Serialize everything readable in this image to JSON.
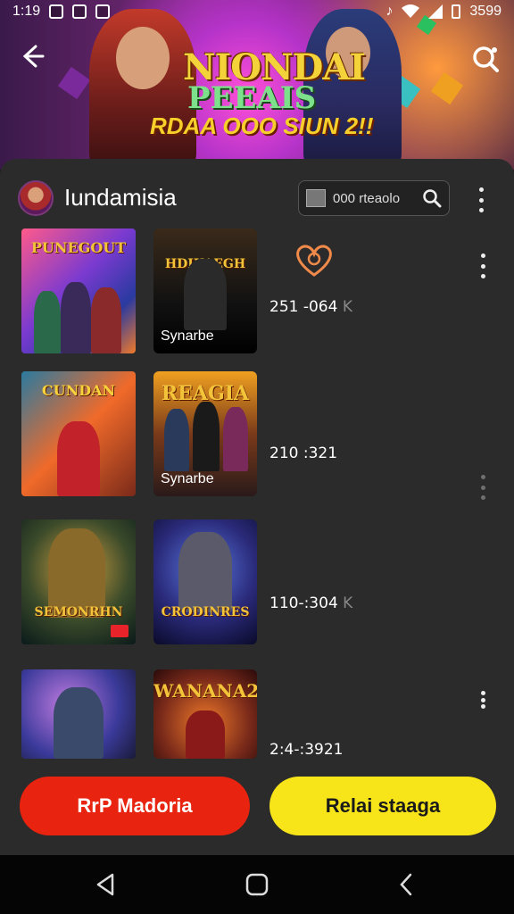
{
  "status_bar": {
    "time": "1:19",
    "right_text": "3599"
  },
  "hero": {
    "title": "NIONDAI",
    "subtitle": "PEEAIS",
    "tagline": "RDAA OOO SIUN 2!!"
  },
  "channel": {
    "name": "Iundamisia",
    "search_placeholder": "000 rteaolo"
  },
  "rows": [
    {
      "tile1_label": "PUNEGOUT",
      "tile2_label": "HDIKAEGH",
      "tile2_caption": "Synarbe",
      "stat": "251 -064",
      "stat_tail": "K"
    },
    {
      "tile1_label": "CUNDAN",
      "tile2_label": "REAGIA",
      "tile2_caption": "Synarbe",
      "stat": "210 :321",
      "stat_tail": ""
    },
    {
      "tile1_label": "SEMONRHN",
      "tile2_label": "CRODINRES",
      "tile2_caption": "",
      "stat": "110-:304",
      "stat_tail": "K"
    },
    {
      "tile1_label": "",
      "tile2_label": "WANANA2",
      "tile2_caption": "",
      "stat": "2:4-:3921",
      "stat_tail": ""
    }
  ],
  "buttons": {
    "primary": "RrP Madoria",
    "secondary": "Relai staaga"
  },
  "colors": {
    "primary": "#e8230f",
    "secondary": "#f7e51a",
    "panel": "#2b2b2b"
  }
}
